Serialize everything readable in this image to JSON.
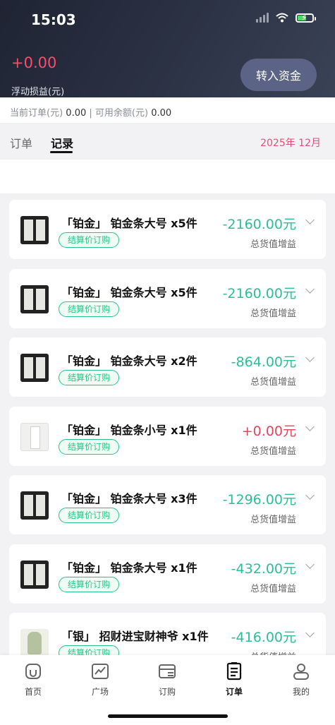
{
  "status_bar": {
    "time": "15:03"
  },
  "header": {
    "pnl_value": "+0.00",
    "pnl_label": "浮动损益(元)",
    "transfer_button": "转入资金"
  },
  "balance": {
    "order_label": "当前订单(元)",
    "order_value": "0.00",
    "separator": "|",
    "available_label": "可用余额(元)",
    "available_value": "0.00"
  },
  "tabs": {
    "orders": "订单",
    "records": "记录",
    "month": "2025年 12月"
  },
  "records": [
    {
      "title": "「铂金」 铂金条大号 x5件",
      "tag": "结算价订购",
      "amount": "-2160.00元",
      "amount_label": "总货值增益",
      "color": "#2bbf96",
      "thumb": "large"
    },
    {
      "title": "「铂金」 铂金条大号 x5件",
      "tag": "结算价订购",
      "amount": "-2160.00元",
      "amount_label": "总货值增益",
      "color": "#2bbf96",
      "thumb": "large"
    },
    {
      "title": "「铂金」 铂金条大号 x2件",
      "tag": "结算价订购",
      "amount": "-864.00元",
      "amount_label": "总货值增益",
      "color": "#2bbf96",
      "thumb": "large"
    },
    {
      "title": "「铂金」 铂金条小号 x1件",
      "tag": "结算价订购",
      "amount": "+0.00元",
      "amount_label": "总货值增益",
      "color": "#e8435c",
      "thumb": "small"
    },
    {
      "title": "「铂金」 铂金条大号 x3件",
      "tag": "结算价订购",
      "amount": "-1296.00元",
      "amount_label": "总货值增益",
      "color": "#2bbf96",
      "thumb": "large"
    },
    {
      "title": "「铂金」 铂金条大号 x1件",
      "tag": "结算价订购",
      "amount": "-432.00元",
      "amount_label": "总货值增益",
      "color": "#2bbf96",
      "thumb": "large"
    },
    {
      "title": "「银」 招财进宝财神爷 x1件",
      "tag": "结算价订购",
      "amount": "-416.00元",
      "amount_label": "总货值增益",
      "color": "#2bbf96",
      "thumb": "figure"
    }
  ],
  "nav": [
    {
      "label": "首页",
      "icon": "home-icon"
    },
    {
      "label": "广场",
      "icon": "chart-icon"
    },
    {
      "label": "订购",
      "icon": "wallet-icon"
    },
    {
      "label": "订单",
      "icon": "document-icon",
      "active": true
    },
    {
      "label": "我的",
      "icon": "user-icon"
    }
  ]
}
